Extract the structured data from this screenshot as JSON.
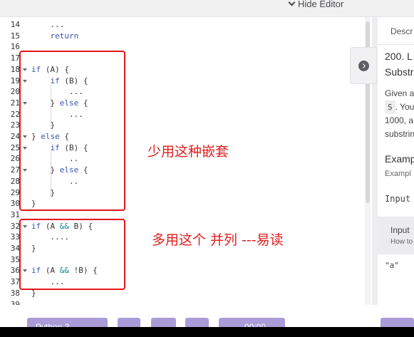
{
  "topbar": {
    "hide_editor_label": "Hide Editor"
  },
  "editor": {
    "lines": [
      {
        "n": "14",
        "code": "    ...",
        "fold": false
      },
      {
        "n": "15",
        "code": "    return",
        "fold": false
      },
      {
        "n": "16",
        "code": "",
        "fold": false
      },
      {
        "n": "17",
        "code": "",
        "fold": false
      },
      {
        "n": "18",
        "code": "if (A) {",
        "fold": true
      },
      {
        "n": "19",
        "code": "    if (B) {",
        "fold": true
      },
      {
        "n": "20",
        "code": "        ...",
        "fold": false
      },
      {
        "n": "21",
        "code": "    } else {",
        "fold": true
      },
      {
        "n": "22",
        "code": "        ...",
        "fold": false
      },
      {
        "n": "23",
        "code": "    }",
        "fold": false
      },
      {
        "n": "24",
        "code": "} else {",
        "fold": true
      },
      {
        "n": "25",
        "code": "    if (B) {",
        "fold": true
      },
      {
        "n": "26",
        "code": "        ..",
        "fold": false
      },
      {
        "n": "27",
        "code": "    } else {",
        "fold": true
      },
      {
        "n": "28",
        "code": "        ..",
        "fold": false
      },
      {
        "n": "29",
        "code": "    }",
        "fold": false
      },
      {
        "n": "30",
        "code": "}",
        "fold": false
      },
      {
        "n": "31",
        "code": "",
        "fold": false
      },
      {
        "n": "32",
        "code": "if (A && B) {",
        "fold": true
      },
      {
        "n": "33",
        "code": "    ....",
        "fold": false
      },
      {
        "n": "34",
        "code": "}",
        "fold": false
      },
      {
        "n": "35",
        "code": "",
        "fold": false
      },
      {
        "n": "36",
        "code": "if (A && !B) {",
        "fold": true
      },
      {
        "n": "37",
        "code": "    ...",
        "fold": false
      },
      {
        "n": "38",
        "code": "}",
        "fold": false
      },
      {
        "n": "39",
        "code": "",
        "fold": false
      }
    ]
  },
  "annotations": {
    "nested_note": "少用这种嵌套",
    "parallel_note": "多用这个 并列 ---易读"
  },
  "panel": {
    "tab_label": "Descr",
    "title_line1": "200. L",
    "title_line2": "Substr",
    "body_line1": "Given a",
    "body_code": "S",
    "body_line2_rest": ". You",
    "body_line3": "1000, a",
    "body_line4": "substrin",
    "example_heading": "Examp",
    "example_sub": "Exampl",
    "input_label": "Input",
    "card_title": "Input",
    "card_sub": "How to",
    "value": "\"a\""
  },
  "bottombar": {
    "btn1_label": "Python 3",
    "btn5_label": "00:00"
  },
  "colors": {
    "accent": "#a99cd8",
    "annotation": "#e61414",
    "keyword": "#3a54b5"
  }
}
